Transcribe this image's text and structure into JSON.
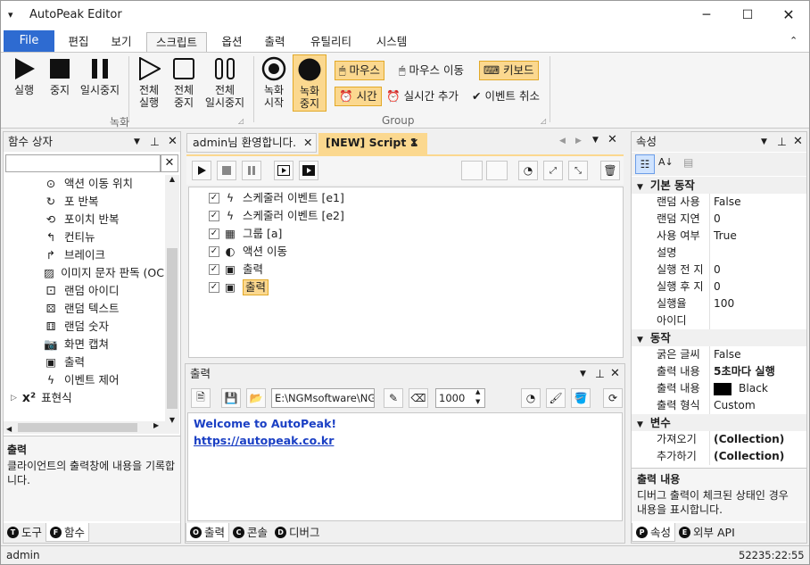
{
  "window": {
    "title": "AutoPeak Editor",
    "app_menu_icon": "caret-down-icon"
  },
  "ribbon_tabs": [
    "File",
    "편집",
    "보기",
    "스크립트",
    "옵션",
    "출력",
    "유틸리티",
    "시스템"
  ],
  "ribbon_active_tab": "스크립트",
  "ribbon": {
    "run_l1": "실행",
    "stop_l1": "중지",
    "pause_l1": "일시중지",
    "allrun_l1": "전체",
    "allrun_l2": "실행",
    "allstop_l1": "전체",
    "allstop_l2": "중지",
    "allpause_l1": "전체",
    "allpause_l2": "일시중지",
    "group_record": "녹화",
    "recstart_l1": "녹화",
    "recstart_l2": "시작",
    "recstop_l1": "녹화",
    "recstop_l2": "중지",
    "mouse": "마우스",
    "mouse_move": "마우스 이동",
    "keyboard": "키보드",
    "time": "시간",
    "realtime_add": "실시간 추가",
    "event_cancel": "이벤트 취소",
    "group_group": "Group"
  },
  "left_panel": {
    "title": "함수 상자",
    "items": [
      "액션 이동 위치",
      "포 반복",
      "포이치 반복",
      "컨티뉴",
      "브레이크",
      "이미지 문자 판독 (OC",
      "랜덤 아이디",
      "랜덤 텍스트",
      "랜덤 숫자",
      "화면 캡쳐",
      "출력",
      "이벤트 제어"
    ],
    "expand_item": "표현식",
    "desc_title": "출력",
    "desc_text": "클라이언트의 출력창에 내용을 기록합니다.",
    "tabs": [
      "도구",
      "함수"
    ]
  },
  "doc_tabs": [
    "admin님 환영합니다.",
    "[NEW] Script 1"
  ],
  "script_tree": [
    {
      "label": "스케줄러 이벤트 [e1]"
    },
    {
      "label": "스케줄러 이벤트 [e2]"
    },
    {
      "label": "그룹 [a]"
    },
    {
      "label": "액션 이동"
    },
    {
      "label": "출력"
    },
    {
      "label": "출력"
    }
  ],
  "output": {
    "title": "출력",
    "path": "E:\\NGMsoftware\\NG",
    "limit": "1000",
    "welcome": "Welcome to AutoPeak!",
    "link": "https://autopeak.co.kr",
    "tabs": [
      "출력",
      "콘솔",
      "디버그"
    ]
  },
  "properties": {
    "title": "속성",
    "cat1": "기본 동작",
    "rows1": [
      {
        "k": "랜덤 사용",
        "v": "False"
      },
      {
        "k": "랜덤 지연",
        "v": "0"
      },
      {
        "k": "사용 여부",
        "v": "True"
      },
      {
        "k": "설명",
        "v": ""
      },
      {
        "k": "실행 전 지",
        "v": "0"
      },
      {
        "k": "실행 후 지",
        "v": "0"
      },
      {
        "k": "실행율",
        "v": "100"
      },
      {
        "k": "아이디",
        "v": ""
      }
    ],
    "cat2": "동작",
    "rows2": [
      {
        "k": "굵은 글씨",
        "v": "False"
      },
      {
        "k": "출력 내용",
        "v": "5초마다 실행"
      },
      {
        "k": "출력 내용",
        "v": "Black"
      },
      {
        "k": "출력 형식",
        "v": "Custom"
      }
    ],
    "cat3": "변수",
    "rows3": [
      {
        "k": "가져오기",
        "v": "(Collection)"
      },
      {
        "k": "추가하기",
        "v": "(Collection)"
      }
    ],
    "desc_title": "출력 내용",
    "desc_text": "디버그 출력이 체크된 상태인 경우 내용을 표시합니다.",
    "tabs": [
      "속성",
      "외부 API"
    ]
  },
  "status": {
    "user": "admin",
    "clock": "52235:22:55"
  },
  "colors": {
    "file_tab": "#2e6bd1",
    "highlight": "#fbd88f",
    "link": "#1a3fc4"
  }
}
